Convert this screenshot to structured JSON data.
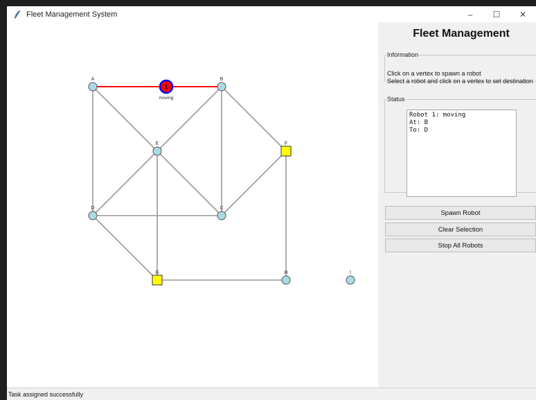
{
  "window": {
    "title": "Fleet Management System",
    "controls": {
      "minimize": "–",
      "maximize": "☐",
      "close": "✕"
    }
  },
  "panel": {
    "title": "Fleet Management",
    "info": {
      "legend": "Information",
      "lines": [
        "Click on a vertex to spawn a robot",
        "Select a robot and click on a vertex to set destination"
      ]
    },
    "status": {
      "legend": "Status",
      "text": "Robot 1: moving\nAt: B\nTo: D"
    },
    "buttons": {
      "spawn": "Spawn Robot",
      "clear": "Clear Selection",
      "stop": "Stop All Robots"
    }
  },
  "statusbar": {
    "message": "Task assigned successfully"
  },
  "graph": {
    "colors": {
      "vertex": "#add8e6",
      "station": "#ffff00",
      "edge": "#999999",
      "path": "#ff0000",
      "robot_fill": "#ff0000",
      "robot_outline": "#0000ff"
    },
    "vertices": [
      {
        "label": "A",
        "kind": "vertex"
      },
      {
        "label": "B",
        "kind": "vertex"
      },
      {
        "label": "E",
        "kind": "vertex"
      },
      {
        "label": "F",
        "kind": "station"
      },
      {
        "label": "D",
        "kind": "vertex"
      },
      {
        "label": "C",
        "kind": "vertex"
      },
      {
        "label": "G",
        "kind": "station"
      },
      {
        "label": "H",
        "kind": "vertex"
      },
      {
        "label": "I",
        "kind": "vertex"
      }
    ],
    "edges": [
      [
        "A",
        "B"
      ],
      [
        "A",
        "E"
      ],
      [
        "A",
        "D"
      ],
      [
        "B",
        "E"
      ],
      [
        "B",
        "C"
      ],
      [
        "B",
        "F"
      ],
      [
        "E",
        "D"
      ],
      [
        "E",
        "C"
      ],
      [
        "E",
        "G"
      ],
      [
        "D",
        "C"
      ],
      [
        "D",
        "G"
      ],
      [
        "C",
        "F"
      ],
      [
        "F",
        "H"
      ],
      [
        "G",
        "H"
      ]
    ],
    "path": [
      "A",
      "B"
    ],
    "robots": [
      {
        "id": "1",
        "state": "moving"
      }
    ]
  }
}
